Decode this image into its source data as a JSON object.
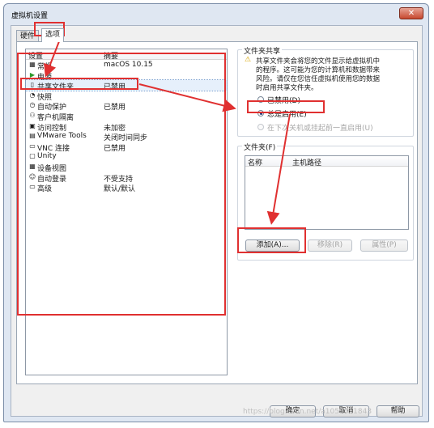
{
  "window": {
    "title": "虚拟机设置",
    "close_glyph": "✕"
  },
  "tabs": [
    {
      "label": "硬件"
    },
    {
      "label": "选项",
      "active": true
    }
  ],
  "settings_list": {
    "col_setting": "设置",
    "col_summary": "摘要",
    "rows": [
      {
        "icon": "general-icon",
        "glyph": "▦",
        "name": "常规",
        "summary": "macOS 10.15"
      },
      {
        "icon": "power-icon",
        "glyph": "▶",
        "name": "电源",
        "summary": ""
      },
      {
        "icon": "shared-folders-icon",
        "glyph": "▯",
        "name": "共享文件夹",
        "summary": "已禁用",
        "selected": true
      },
      {
        "icon": "snapshot-icon",
        "glyph": "◔",
        "name": "快照",
        "summary": ""
      },
      {
        "icon": "autoprotect-icon",
        "glyph": "◷",
        "name": "自动保护",
        "summary": "已禁用"
      },
      {
        "icon": "guest-isolation-icon",
        "glyph": "⚇",
        "name": "客户机隔离",
        "summary": ""
      },
      {
        "icon": "access-control-icon",
        "glyph": "▣",
        "name": "访问控制",
        "summary": "未加密"
      },
      {
        "icon": "vmware-tools-icon",
        "glyph": "▤",
        "name": "VMware Tools",
        "summary": "关闭时间同步"
      },
      {
        "icon": "vnc-icon",
        "glyph": "▭",
        "name": "VNC 连接",
        "summary": "已禁用"
      },
      {
        "icon": "unity-icon",
        "glyph": "▢",
        "name": "Unity",
        "summary": ""
      },
      {
        "icon": "device-view-icon",
        "glyph": "▦",
        "name": "设备视图",
        "summary": ""
      },
      {
        "icon": "autologin-icon",
        "glyph": "☺",
        "name": "自动登录",
        "summary": "不受支持"
      },
      {
        "icon": "advanced-icon",
        "glyph": "▭",
        "name": "高级",
        "summary": "默认/默认"
      }
    ]
  },
  "sharing": {
    "legend": "文件夹共享",
    "description": [
      "共享文件夹会将您的文件显示给虚拟机中",
      "的程序。这可能为您的计算机和数据带来",
      "风险。请仅在您信任虚拟机使用您的数据",
      "时启用共享文件夹。"
    ],
    "options": [
      {
        "label": "已禁用(D)",
        "checked": false,
        "disabled": false
      },
      {
        "label": "总是启用(E)",
        "checked": true,
        "disabled": false
      },
      {
        "label": "在下次关机或挂起前一直启用(U)",
        "checked": false,
        "disabled": true
      }
    ]
  },
  "folders": {
    "legend": "文件夹(F)",
    "col_name": "名称",
    "col_host_path": "主机路径",
    "add_label": "添加(A)...",
    "remove_label": "移除(R)",
    "properties_label": "属性(P)"
  },
  "footer": {
    "ok_label": "确定",
    "cancel_label": "取消",
    "help_label": "帮助",
    "watermark": "https://blog.csdn.net/a1059511843"
  },
  "colors": {
    "annotation": "#e03030",
    "accent": "#1d3d7a"
  }
}
